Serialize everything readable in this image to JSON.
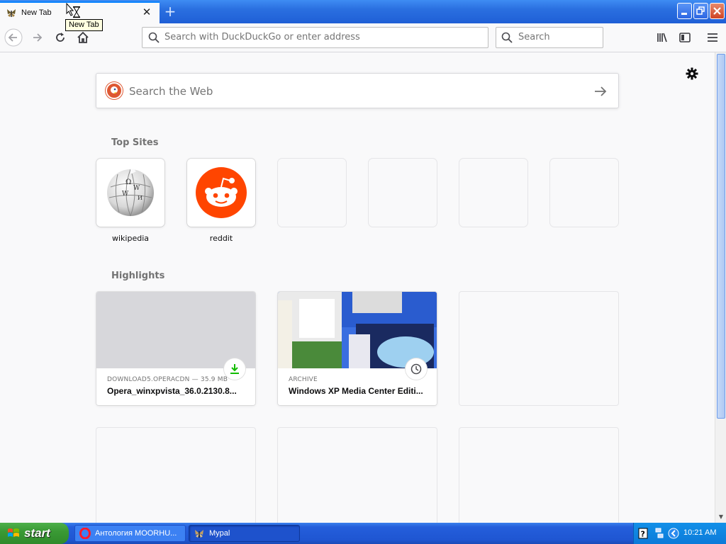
{
  "browser": {
    "tab": {
      "title": "New Tab",
      "favicon": "xp-butterfly-icon"
    },
    "tooltip": "New Tab",
    "new_tab_symbol": "+",
    "window_controls": {
      "minimize": "minimize-icon",
      "maximize": "restore-icon",
      "close": "close-icon"
    },
    "toolbar": {
      "url_placeholder": "Search with DuckDuckGo or enter address",
      "search_placeholder": "Search",
      "icons": [
        "back-icon",
        "forward-icon",
        "reload-icon",
        "home-icon",
        "library-icon",
        "sidebar-icon",
        "menu-icon"
      ]
    }
  },
  "newtab": {
    "web_search_placeholder": "Search the Web",
    "top_sites_title": "Top Sites",
    "top_sites": [
      {
        "label": "wikipedia",
        "icon": "wikipedia-icon"
      },
      {
        "label": "reddit",
        "icon": "reddit-icon"
      },
      {
        "label": ""
      },
      {
        "label": ""
      },
      {
        "label": ""
      },
      {
        "label": ""
      }
    ],
    "highlights_title": "Highlights",
    "highlights": [
      {
        "source": "DOWNLOAD5.OPERACDN — 35.9 MB",
        "title": "Opera_winxpvista_36.0.2130.8...",
        "badge": "download-icon"
      },
      {
        "source": "ARCHIVE",
        "title": "Windows XP Media Center Editi...",
        "badge": "clock-icon"
      }
    ]
  },
  "taskbar": {
    "start_label": "start",
    "buttons": [
      {
        "label": "Антология MOORHU...",
        "icon": "opera-icon"
      },
      {
        "label": "Mypal",
        "icon": "mypal-icon"
      }
    ],
    "clock": "10:21 AM"
  },
  "colors": {
    "accent": "#0a84ff",
    "reddit": "#ff4500",
    "ddg": "#de5833",
    "xp_blue": "#245edb",
    "start_green": "#3a9a35"
  }
}
